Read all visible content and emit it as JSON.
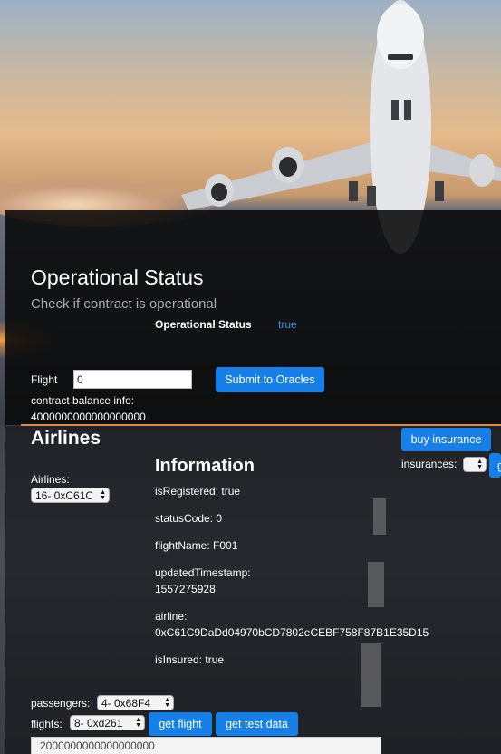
{
  "operational": {
    "title": "Operational Status",
    "subtitle": "Check if contract is operational",
    "status_label": "Operational Status",
    "status_value": "true"
  },
  "oracle": {
    "flight_label": "Flight",
    "flight_value": "0",
    "submit_label": "Submit to Oracles",
    "balance_label": "contract balance info:",
    "balance_value": "4000000000000000000"
  },
  "airlines": {
    "title": "Airlines",
    "select_label": "Airlines:",
    "selected": "16- 0xC61C"
  },
  "insurance": {
    "buy_label": "buy insurance",
    "insurances_label": "insurances:",
    "cut_button_label": "g"
  },
  "information": {
    "title": "Information",
    "is_registered": "isRegistered: true",
    "status_code": "statusCode: 0",
    "flight_name": "flightName: F001",
    "updated_label": "updatedTimestamp:",
    "updated_value": "1557275928",
    "airline_label": "airline:",
    "airline_value": "0xC61C9DaDd04970bCD7802eCEBF758F87B1E35D15",
    "is_insured": "isInsured: true"
  },
  "controls": {
    "passengers_label": "passengers:",
    "passengers_selected": "4- 0x68F4",
    "flights_label": "flights:",
    "flights_selected": "8- 0xd261",
    "get_flight_label": "get flight",
    "get_test_data_label": "get test data",
    "amount_value": "2000000000000000000"
  },
  "colors": {
    "accent": "#1680e8",
    "status_true": "#3b8ee0",
    "divider": "#e08a44"
  }
}
